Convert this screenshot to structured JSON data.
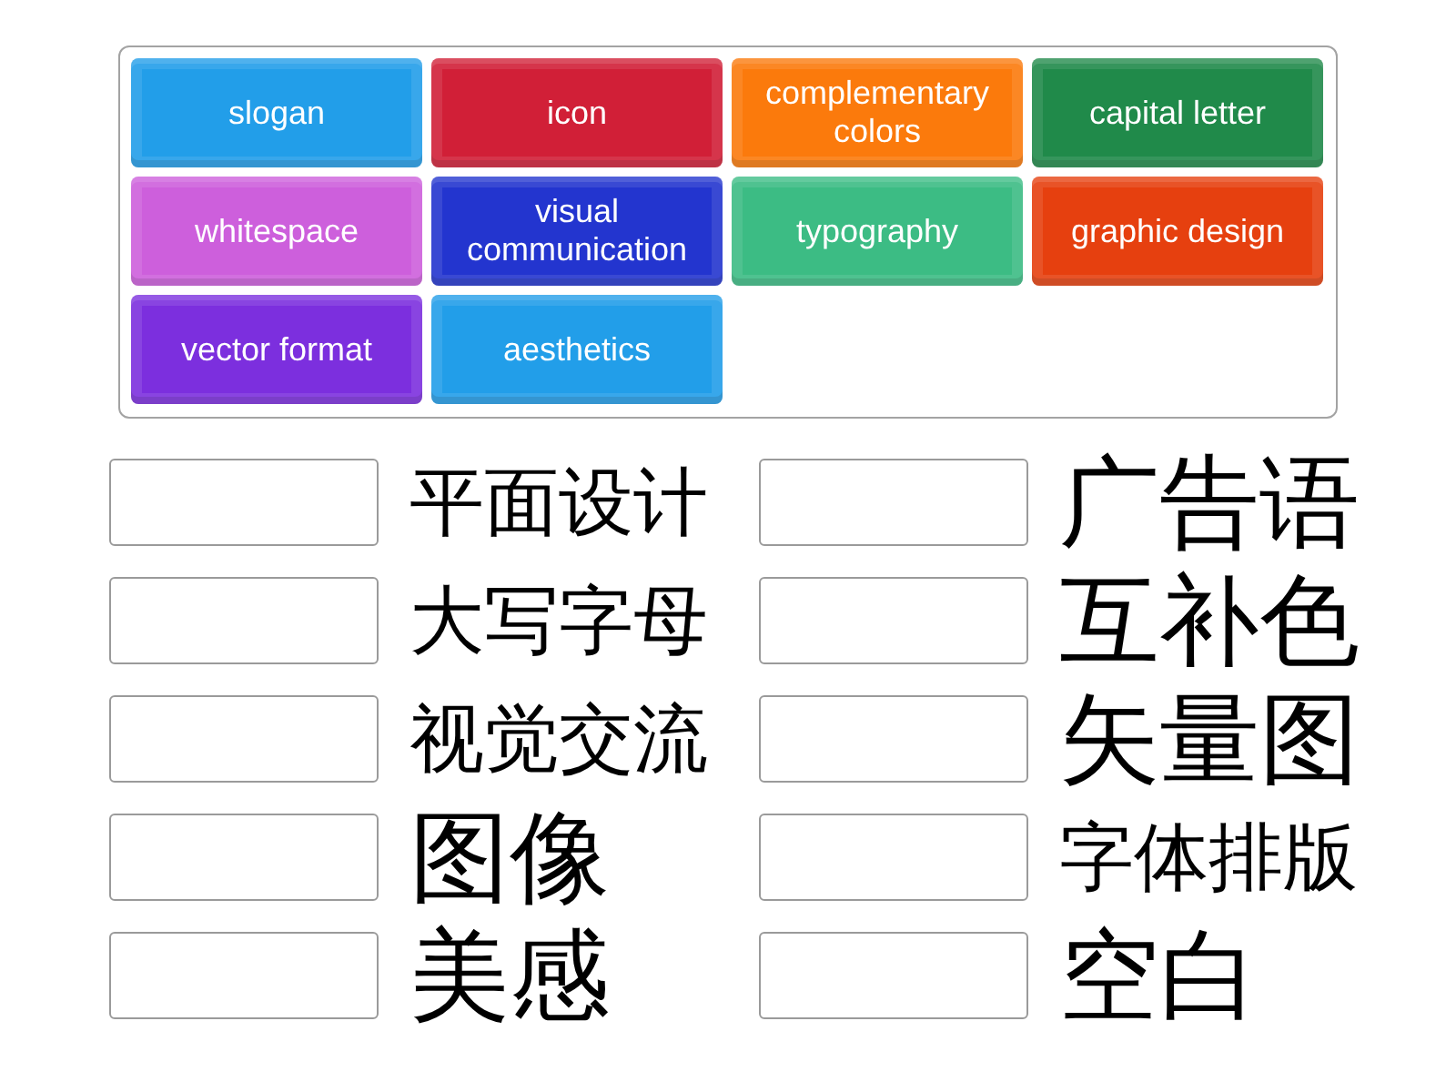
{
  "tiles": [
    {
      "label": "slogan",
      "color": "#229ee9"
    },
    {
      "label": "icon",
      "color": "#d11f37"
    },
    {
      "label": "complementary colors",
      "color": "#fb7a0c"
    },
    {
      "label": "capital letter",
      "color": "#208a4a"
    },
    {
      "label": "whitespace",
      "color": "#cd5fdc"
    },
    {
      "label": "visual communication",
      "color": "#2335cf"
    },
    {
      "label": "typography",
      "color": "#3cbc84"
    },
    {
      "label": "graphic design",
      "color": "#e6400f"
    },
    {
      "label": "vector format",
      "color": "#7c2fde"
    },
    {
      "label": "aesthetics",
      "color": "#229ee9"
    }
  ],
  "match_columns": [
    {
      "items": [
        {
          "text": "平面设计"
        },
        {
          "text": "大写字母"
        },
        {
          "text": "视觉交流"
        },
        {
          "text": "图像"
        },
        {
          "text": "美感"
        }
      ]
    },
    {
      "items": [
        {
          "text": "广告语"
        },
        {
          "text": "互补色"
        },
        {
          "text": "矢量图"
        },
        {
          "text": "字体排版"
        },
        {
          "text": "空白"
        }
      ]
    }
  ]
}
